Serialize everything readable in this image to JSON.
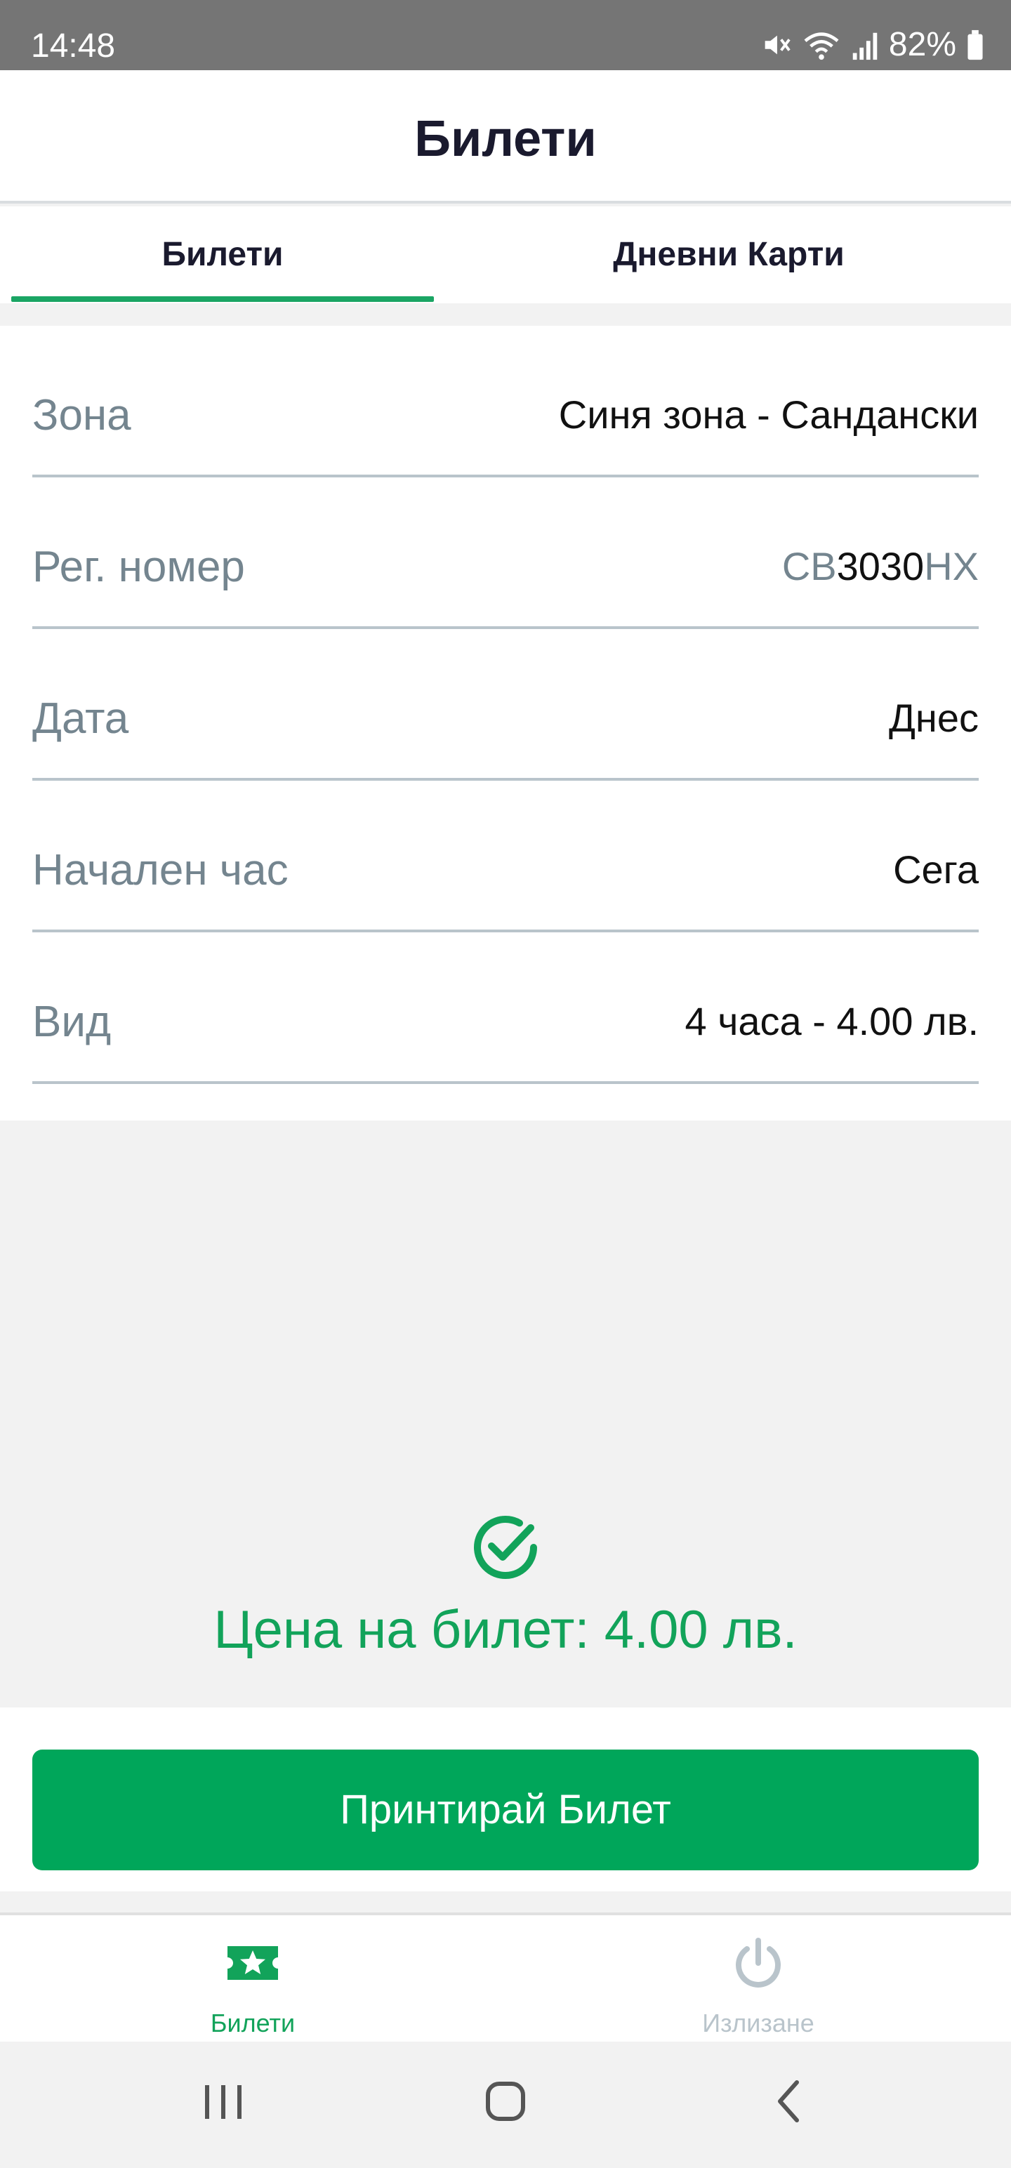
{
  "status_bar": {
    "time": "14:48",
    "battery": "82%"
  },
  "header": {
    "title": "Билети"
  },
  "tabs": [
    {
      "label": "Билети",
      "active": true
    },
    {
      "label": "Дневни Карти",
      "active": false
    }
  ],
  "form": {
    "zone": {
      "label": "Зона",
      "value": "Синя зона - Сандански"
    },
    "plate": {
      "label": "Рег. номер",
      "prefix": "СВ",
      "number": "3030",
      "suffix": "НХ"
    },
    "date": {
      "label": "Дата",
      "value": "Днес"
    },
    "start_time": {
      "label": "Начален час",
      "value": "Сега"
    },
    "type": {
      "label": "Вид",
      "value": "4 часа - 4.00 лв."
    }
  },
  "price": {
    "text": "Цена на билет: 4.00 лв."
  },
  "action": {
    "print_label": "Принтирай Билет"
  },
  "bottom_nav": {
    "tickets_label": "Билети",
    "logout_label": "Излизане"
  },
  "icons": {
    "mute": "mute-icon",
    "wifi": "wifi-icon",
    "signal": "signal-icon",
    "battery": "battery-icon",
    "check": "check-circle-icon",
    "ticket": "ticket-star-icon",
    "power": "power-icon",
    "recents": "recents-icon",
    "home": "home-icon",
    "back": "back-icon"
  },
  "colors": {
    "accent": "#00a65a",
    "label": "#74858f",
    "status_bar": "#757575",
    "inactive": "#b9c4cb"
  }
}
